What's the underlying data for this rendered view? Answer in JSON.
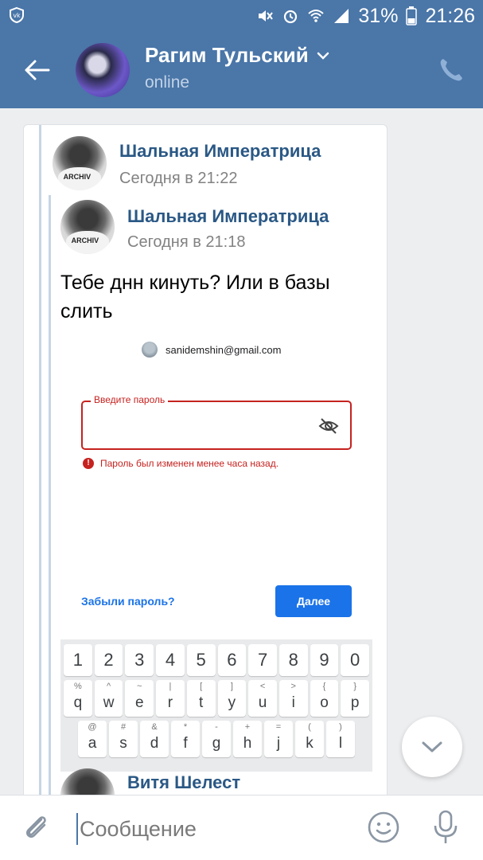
{
  "status_bar": {
    "battery": "31%",
    "time": "21:26"
  },
  "header": {
    "contact_name": "Рагим Тульский",
    "status": "online"
  },
  "message": {
    "forward_author": "Шальная Императрица",
    "forward_time": "Сегодня в 21:22",
    "inner_author": "Шальная Императрица",
    "inner_time": "Сегодня в 21:18",
    "text": "Тебе днн кинуть? Или в базы слить",
    "next_author": "Витя Шелест"
  },
  "screenshot": {
    "email": "sanidemshin@gmail.com",
    "password_label": "Введите пароль",
    "error": "Пароль был изменен менее часа назад.",
    "forgot_link": "Забыли пароль?",
    "next_button": "Далее",
    "keyboard": {
      "numbers": [
        "1",
        "2",
        "3",
        "4",
        "5",
        "6",
        "7",
        "8",
        "9",
        "0"
      ],
      "row1": [
        {
          "sup": "%",
          "key": "q"
        },
        {
          "sup": "^",
          "key": "w"
        },
        {
          "sup": "~",
          "key": "e"
        },
        {
          "sup": "|",
          "key": "r"
        },
        {
          "sup": "[",
          "key": "t"
        },
        {
          "sup": "]",
          "key": "y"
        },
        {
          "sup": "<",
          "key": "u"
        },
        {
          "sup": ">",
          "key": "i"
        },
        {
          "sup": "{",
          "key": "o"
        },
        {
          "sup": "}",
          "key": "p"
        }
      ],
      "row2": [
        {
          "sup": "@",
          "key": "a"
        },
        {
          "sup": "#",
          "key": "s"
        },
        {
          "sup": "&",
          "key": "d"
        },
        {
          "sup": "*",
          "key": "f"
        },
        {
          "sup": "-",
          "key": "g"
        },
        {
          "sup": "+",
          "key": "h"
        },
        {
          "sup": "=",
          "key": "j"
        },
        {
          "sup": "(",
          "key": "k"
        },
        {
          "sup": ")",
          "key": "l"
        }
      ]
    }
  },
  "composer": {
    "placeholder": "Сообщение"
  },
  "colors": {
    "header": "#4a76a8",
    "link": "#2a5885",
    "error": "#c5221f",
    "google_blue": "#1a73e8"
  }
}
